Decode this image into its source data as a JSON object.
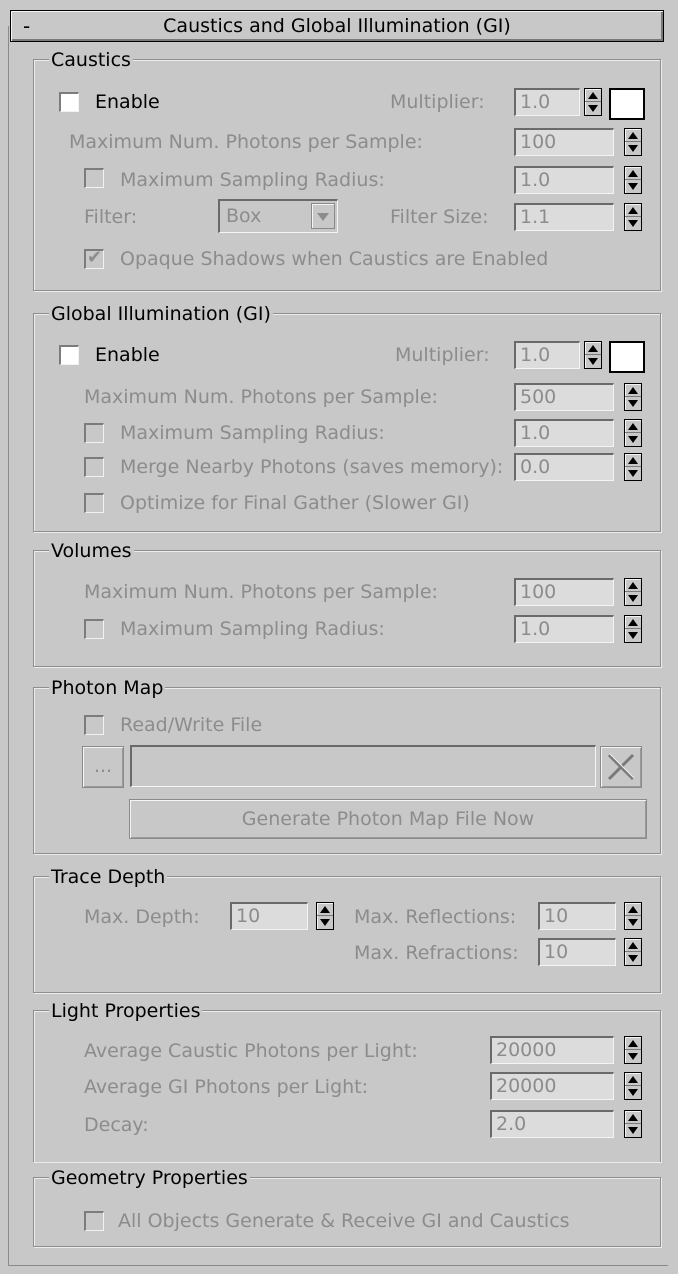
{
  "rollout": {
    "collapse_symbol": "-",
    "title": "Caustics and Global Illumination (GI)"
  },
  "caustics": {
    "legend": "Caustics",
    "enable_label": "Enable",
    "multiplier_label": "Multiplier:",
    "multiplier_value": "1.0",
    "swatch_color": "#ffffff",
    "max_photons_label": "Maximum Num. Photons per Sample:",
    "max_photons_value": "100",
    "max_radius_label": "Maximum Sampling Radius:",
    "max_radius_value": "1.0",
    "filter_label": "Filter:",
    "filter_value": "Box",
    "filter_size_label": "Filter Size:",
    "filter_size_value": "1.1",
    "opaque_label": "Opaque Shadows when Caustics are Enabled"
  },
  "gi": {
    "legend": "Global Illumination (GI)",
    "enable_label": "Enable",
    "multiplier_label": "Multiplier:",
    "multiplier_value": "1.0",
    "swatch_color": "#ffffff",
    "max_photons_label": "Maximum Num. Photons per Sample:",
    "max_photons_value": "500",
    "max_radius_label": "Maximum Sampling Radius:",
    "max_radius_value": "1.0",
    "merge_label": "Merge Nearby Photons (saves memory):",
    "merge_value": "0.0",
    "optimize_label": "Optimize for Final Gather (Slower GI)"
  },
  "volumes": {
    "legend": "Volumes",
    "max_photons_label": "Maximum Num. Photons per Sample:",
    "max_photons_value": "100",
    "max_radius_label": "Maximum Sampling Radius:",
    "max_radius_value": "1.0"
  },
  "photon_map": {
    "legend": "Photon Map",
    "readwrite_label": "Read/Write File",
    "browse_label": "...",
    "file_path": "",
    "clear_icon": "x-icon",
    "generate_label": "Generate Photon Map File Now"
  },
  "trace_depth": {
    "legend": "Trace Depth",
    "max_depth_label": "Max. Depth:",
    "max_depth_value": "10",
    "max_reflections_label": "Max. Reflections:",
    "max_reflections_value": "10",
    "max_refractions_label": "Max. Refractions:",
    "max_refractions_value": "10"
  },
  "light_props": {
    "legend": "Light Properties",
    "avg_caustic_label": "Average Caustic Photons per Light:",
    "avg_caustic_value": "20000",
    "avg_gi_label": "Average GI Photons per Light:",
    "avg_gi_value": "20000",
    "decay_label": "Decay:",
    "decay_value": "2.0"
  },
  "geometry_props": {
    "legend": "Geometry Properties",
    "all_objects_label": "All Objects Generate & Receive GI and Caustics"
  }
}
